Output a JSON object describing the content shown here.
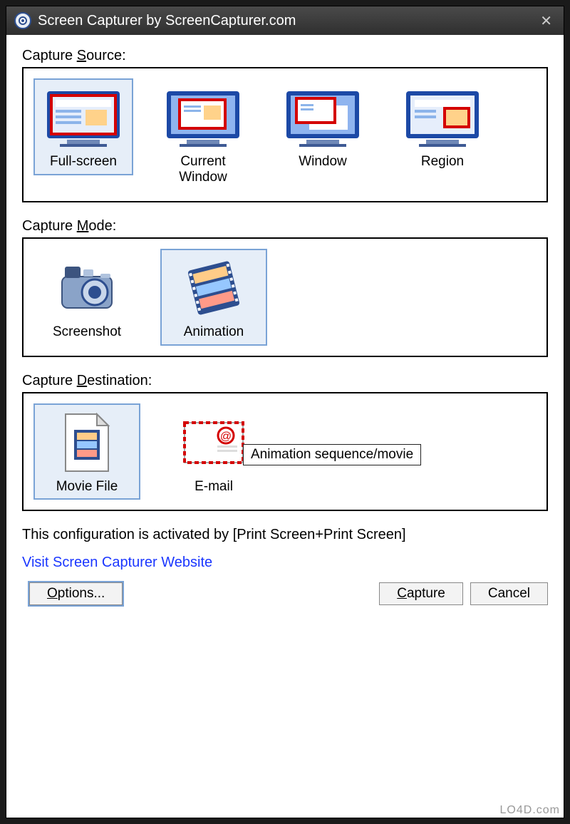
{
  "titlebar": {
    "title": "Screen Capturer by ScreenCapturer.com"
  },
  "sections": {
    "source_label_pre": "Capture ",
    "source_label_u": "S",
    "source_label_post": "ource:",
    "mode_label_pre": "Capture ",
    "mode_label_u": "M",
    "mode_label_post": "ode:",
    "dest_label_pre": "Capture ",
    "dest_label_u": "D",
    "dest_label_post": "estination:"
  },
  "source": {
    "items": [
      {
        "label": "Full-screen",
        "selected": true
      },
      {
        "label": "Current Window",
        "selected": false
      },
      {
        "label": "Window",
        "selected": false
      },
      {
        "label": "Region",
        "selected": false
      }
    ]
  },
  "mode": {
    "items": [
      {
        "label": "Screenshot",
        "selected": false
      },
      {
        "label": "Animation",
        "selected": true
      }
    ]
  },
  "destination": {
    "items": [
      {
        "label": "Movie File",
        "selected": true
      },
      {
        "label": "E-mail",
        "selected": false
      }
    ]
  },
  "tooltip": "Animation sequence/movie",
  "status": "This configuration is activated by [Print Screen+Print Screen]",
  "link": "Visit Screen Capturer Website",
  "buttons": {
    "options_u": "O",
    "options_post": "ptions...",
    "capture_u": "C",
    "capture_post": "apture",
    "cancel": "Cancel"
  },
  "watermark": "LO4D.com"
}
